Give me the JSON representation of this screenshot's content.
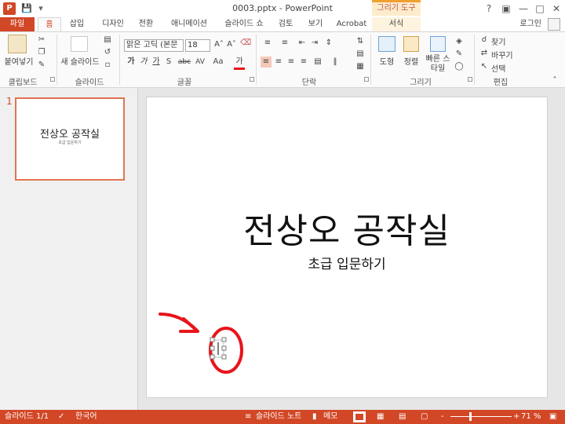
{
  "titlebar": {
    "document_title": "0003.pptx - PowerPoint",
    "app_icon": "P",
    "context_banner": "그리기 도구",
    "help": "?",
    "restore": "▣",
    "minimize": "—",
    "maximize": "□",
    "close": "✕"
  },
  "tabs": {
    "file": "파일",
    "home": "홈",
    "insert": "삽입",
    "design": "디자인",
    "transitions": "전환",
    "animations": "애니메이션",
    "slideshow": "슬라이드 쇼",
    "review": "검토",
    "view": "보기",
    "acrobat": "Acrobat",
    "format": "서식",
    "login": "로그인"
  },
  "ribbon": {
    "clipboard": {
      "paste": "붙여넣기",
      "group": "클립보드"
    },
    "slides": {
      "new_slide": "새 슬라이드",
      "group": "슬라이드"
    },
    "font": {
      "font_name": "맑은 고딕 (본문",
      "font_size": "18",
      "bold": "가",
      "italic": "가",
      "underline": "가",
      "shadow": "S",
      "strike": "abc",
      "spacing": "AV",
      "case": "Aa",
      "color": "가",
      "group": "글꼴"
    },
    "paragraph": {
      "group": "단락"
    },
    "drawing": {
      "shapes": "도형",
      "arrange": "정렬",
      "quick_styles": "빠른 스타일",
      "group": "그리기"
    },
    "editing": {
      "find": "찾기",
      "replace": "바꾸기",
      "select": "선택",
      "group": "편집"
    }
  },
  "thumbnail": {
    "number": "1",
    "title": "전상오 공작실",
    "subtitle": "초급 입문하기"
  },
  "slide": {
    "title": "전상오 공작실",
    "subtitle": "초급 입문하기"
  },
  "status": {
    "slide_indicator": "슬라이드 1/1",
    "language": "한국어",
    "notes": "슬라이드 노트",
    "comments": "메모",
    "zoom_minus": "-",
    "zoom_plus": "+",
    "zoom": "71 %"
  },
  "colors": {
    "accent": "#d24726",
    "annotation": "#e8141b"
  },
  "zoom_level": 0.71
}
